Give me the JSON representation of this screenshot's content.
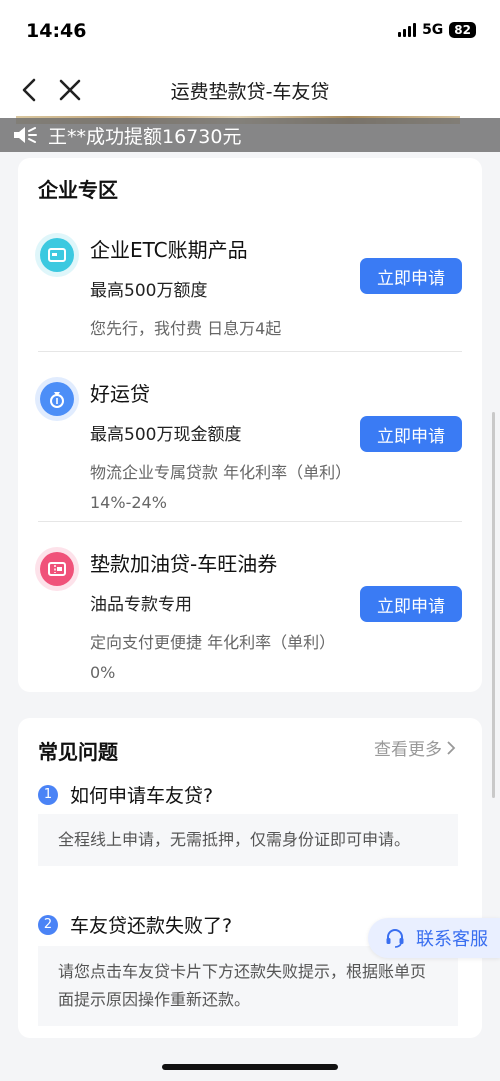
{
  "status": {
    "time": "14:46",
    "network": "5G",
    "battery": "82"
  },
  "nav": {
    "title": "运费垫款贷-车友贷"
  },
  "notice": {
    "text": "王**成功提额16730元"
  },
  "enterprise": {
    "title": "企业专区",
    "apply_label": "立即申请",
    "products": [
      {
        "name": "企业ETC账期产品",
        "limit": "最高500万额度",
        "desc": "您先行，我付费 日息万4起",
        "icon": "etc-card-icon",
        "color": "#3cc9e0"
      },
      {
        "name": "好运贷",
        "limit": "最高500万现金额度",
        "desc": "物流企业专属贷款 年化利率（单利）14%-24%",
        "icon": "money-bag-icon",
        "color": "#4c8ef7"
      },
      {
        "name": "垫款加油贷-车旺油券",
        "limit": "油品专款专用",
        "desc": "定向支付更便捷 年化利率（单利）0%",
        "icon": "fuel-ticket-icon",
        "color": "#f0527a"
      }
    ]
  },
  "faq": {
    "title": "常见问题",
    "more_label": "查看更多",
    "items": [
      {
        "num": "1",
        "question": "如何申请车友贷?",
        "answer": "全程线上申请，无需抵押，仅需身份证即可申请。"
      },
      {
        "num": "2",
        "question": "车友贷还款失败了?",
        "answer": "请您点击车友贷卡片下方还款失败提示，根据账单页面提示原因操作重新还款。"
      }
    ]
  },
  "service": {
    "label": "联系客服"
  }
}
